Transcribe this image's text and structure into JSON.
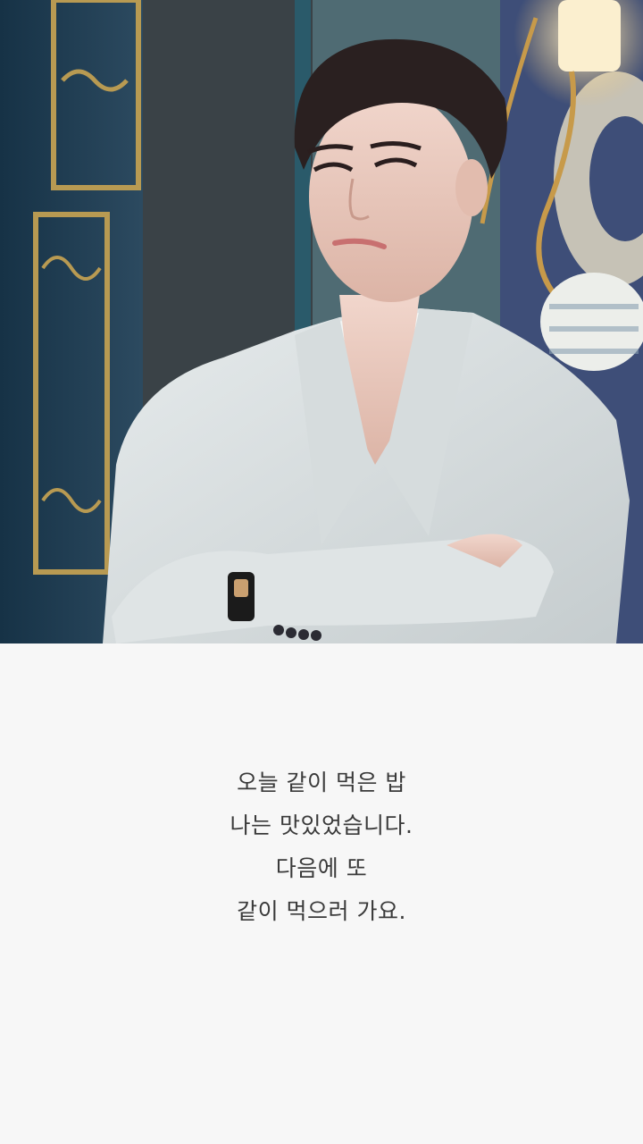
{
  "photo": {
    "subject": "man in white blazer with crossed arms standing beside a dark blue ornate door and a brass wall lamp"
  },
  "caption": {
    "lines": [
      "오늘 같이 먹은 밥",
      "나는 맛있었습니다.",
      "다음에 또",
      "같이 먹으러 가요."
    ]
  },
  "colors": {
    "background": "#f7f7f7",
    "text": "#3a3a3a"
  }
}
